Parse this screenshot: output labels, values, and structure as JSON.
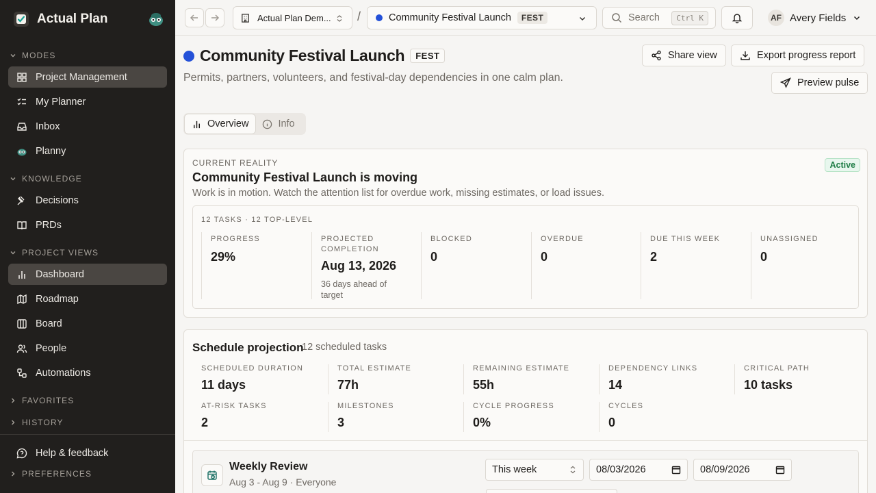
{
  "sidebar": {
    "brand": "Actual Plan",
    "sections": {
      "modes": "MODES",
      "knowledge": "KNOWLEDGE",
      "project_views": "PROJECT VIEWS",
      "favorites": "FAVORITES",
      "history": "HISTORY",
      "preferences": "PREFERENCES"
    },
    "items": {
      "project_management": "Project Management",
      "my_planner": "My Planner",
      "inbox": "Inbox",
      "planny": "Planny",
      "decisions": "Decisions",
      "prds": "PRDs",
      "dashboard": "Dashboard",
      "roadmap": "Roadmap",
      "board": "Board",
      "people": "People",
      "automations": "Automations",
      "help": "Help & feedback"
    }
  },
  "topbar": {
    "workspace": "Actual Plan Dem...",
    "separator": "/",
    "project_name": "Community Festival Launch",
    "project_key": "FEST",
    "search_placeholder": "Search",
    "search_shortcut": "Ctrl K",
    "user_initials": "AF",
    "user_name": "Avery Fields"
  },
  "header": {
    "title": "Community Festival Launch",
    "key": "FEST",
    "subtitle": "Permits, partners, volunteers, and festival-day dependencies in one calm plan.",
    "share": "Share view",
    "export": "Export progress report",
    "preview": "Preview pulse",
    "tabs": {
      "overview": "Overview",
      "info": "Info"
    },
    "accent": "#2451d8"
  },
  "reality": {
    "eyebrow": "CURRENT REALITY",
    "title": "Community Festival Launch is moving",
    "description": "Work is in motion. Watch the attention list for overdue work, missing estimates, or load issues.",
    "status": "Active",
    "tasks_summary": "12 TASKS · 12 TOP-LEVEL",
    "metrics": [
      {
        "label": "PROGRESS",
        "value": "29%",
        "note": ""
      },
      {
        "label": "PROJECTED COMPLETION",
        "value": "Aug 13, 2026",
        "note": "36 days ahead of target"
      },
      {
        "label": "BLOCKED",
        "value": "0",
        "note": ""
      },
      {
        "label": "OVERDUE",
        "value": "0",
        "note": ""
      },
      {
        "label": "DUE THIS WEEK",
        "value": "2",
        "note": ""
      },
      {
        "label": "UNASSIGNED",
        "value": "0",
        "note": ""
      }
    ]
  },
  "schedule": {
    "title": "Schedule projection",
    "subtitle": "12 scheduled tasks",
    "stats": [
      {
        "label": "SCHEDULED DURATION",
        "value": "11 days"
      },
      {
        "label": "TOTAL ESTIMATE",
        "value": "77h"
      },
      {
        "label": "REMAINING ESTIMATE",
        "value": "55h"
      },
      {
        "label": "DEPENDENCY LINKS",
        "value": "14"
      },
      {
        "label": "CRITICAL PATH",
        "value": "10 tasks"
      },
      {
        "label": "AT-RISK TASKS",
        "value": "2"
      },
      {
        "label": "MILESTONES",
        "value": "3"
      },
      {
        "label": "CYCLE PROGRESS",
        "value": "0%"
      },
      {
        "label": "CYCLES",
        "value": "0"
      }
    ]
  },
  "review": {
    "title": "Weekly Review",
    "subtitle": "Aug 3 - Aug 9 · Everyone",
    "range": "This week",
    "start": "08/03/2026",
    "end": "08/09/2026"
  }
}
